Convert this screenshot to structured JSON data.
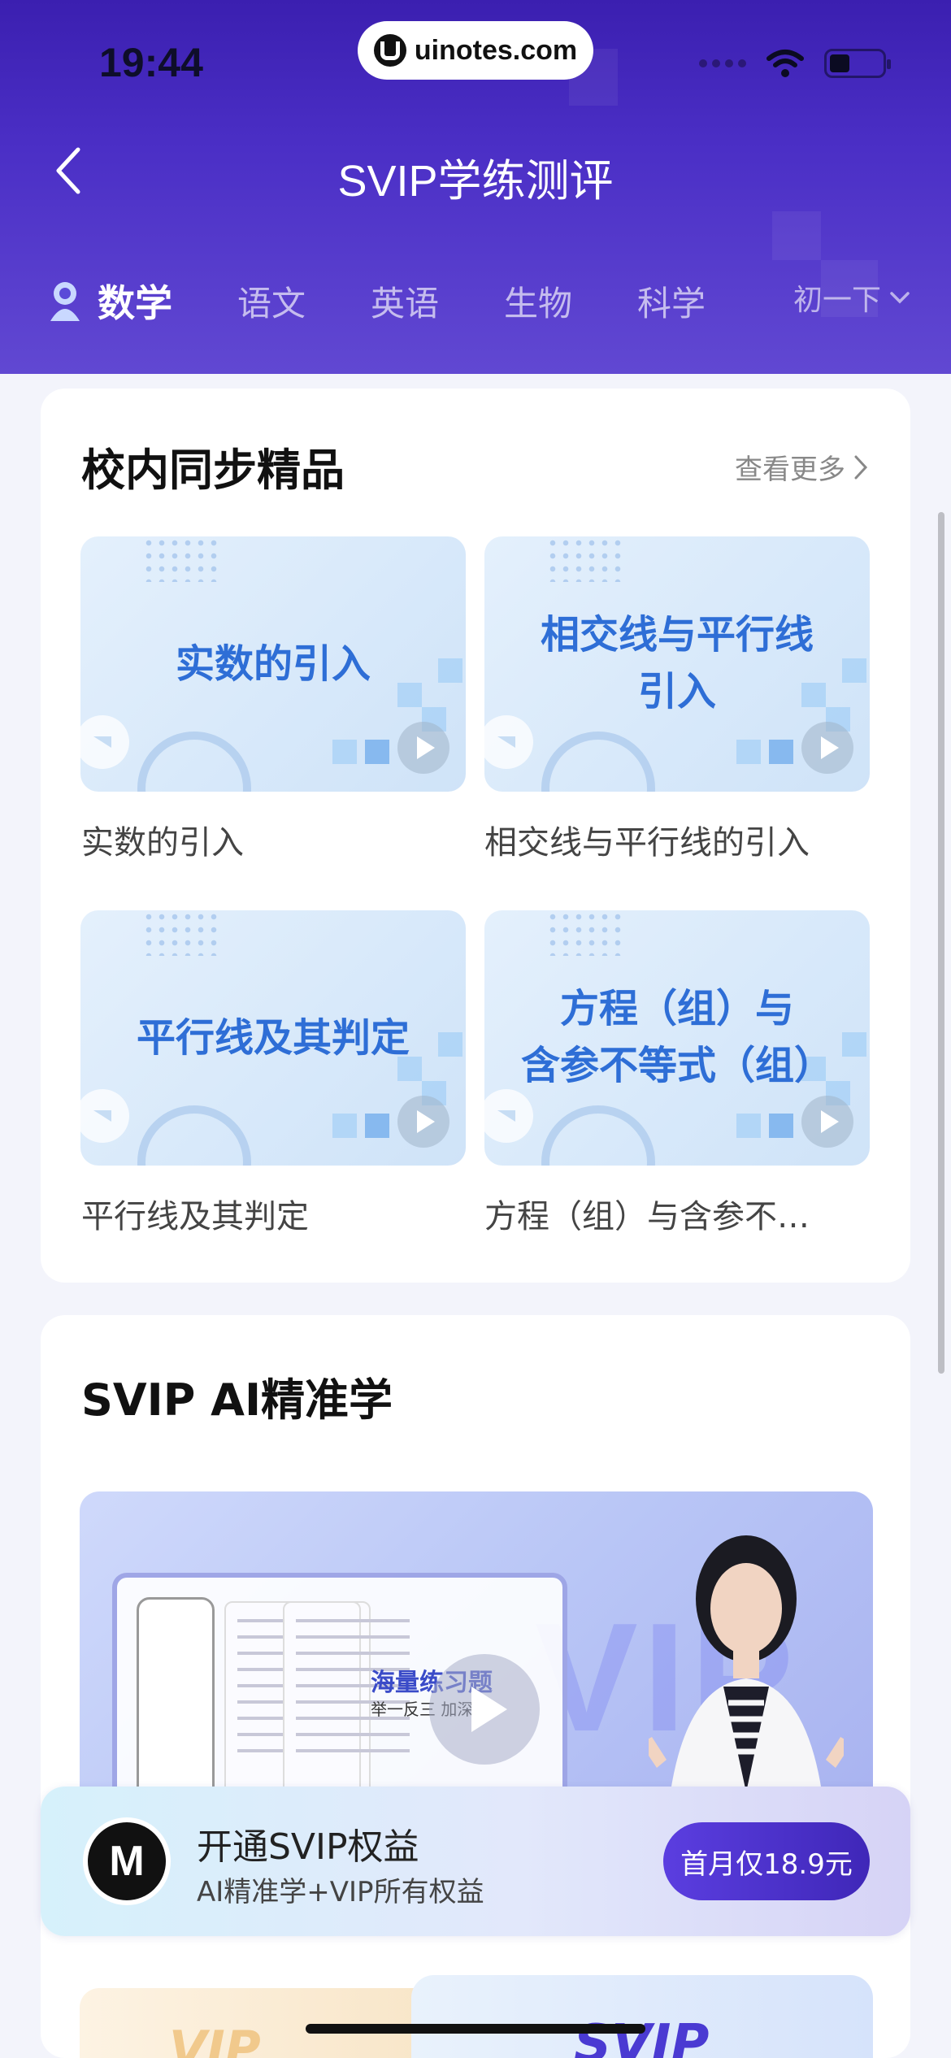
{
  "status_bar": {
    "time": "19:44",
    "url": "uinotes.com"
  },
  "nav": {
    "title": "SVIP学练测评"
  },
  "tabs": [
    {
      "label": "数学",
      "active": true
    },
    {
      "label": "语文",
      "active": false
    },
    {
      "label": "英语",
      "active": false
    },
    {
      "label": "生物",
      "active": false
    },
    {
      "label": "科学",
      "active": false
    }
  ],
  "grade_selector": "初一下",
  "sync_section": {
    "title": "校内同步精品",
    "more": "查看更多",
    "lessons": [
      {
        "thumb_lines": [
          "实数的引入"
        ],
        "name": "实数的引入"
      },
      {
        "thumb_lines": [
          "相交线与平行线",
          "引入"
        ],
        "name": "相交线与平行线的引入"
      },
      {
        "thumb_lines": [
          "平行线及其判定"
        ],
        "name": "平行线及其判定"
      },
      {
        "thumb_lines": [
          "方程（组）与",
          "含参不等式（组）"
        ],
        "name": "方程（组）与含参不…"
      }
    ]
  },
  "ai_section": {
    "title": "SVIP AI精准学",
    "video_headline": "海量练习题",
    "video_subline": "举一反三 加深",
    "video_letters": "VIP"
  },
  "svip_banner": {
    "logo": "M",
    "title": "开通SVIP权益",
    "subtitle": "AI精准学+VIP所有权益",
    "button": "首月仅18.9元"
  },
  "promo": {
    "left": "VIP",
    "right": "SVIP"
  },
  "colors": {
    "header": "#4b2fc6",
    "accent": "#2e6ed6",
    "button": "#5b3ee0"
  }
}
